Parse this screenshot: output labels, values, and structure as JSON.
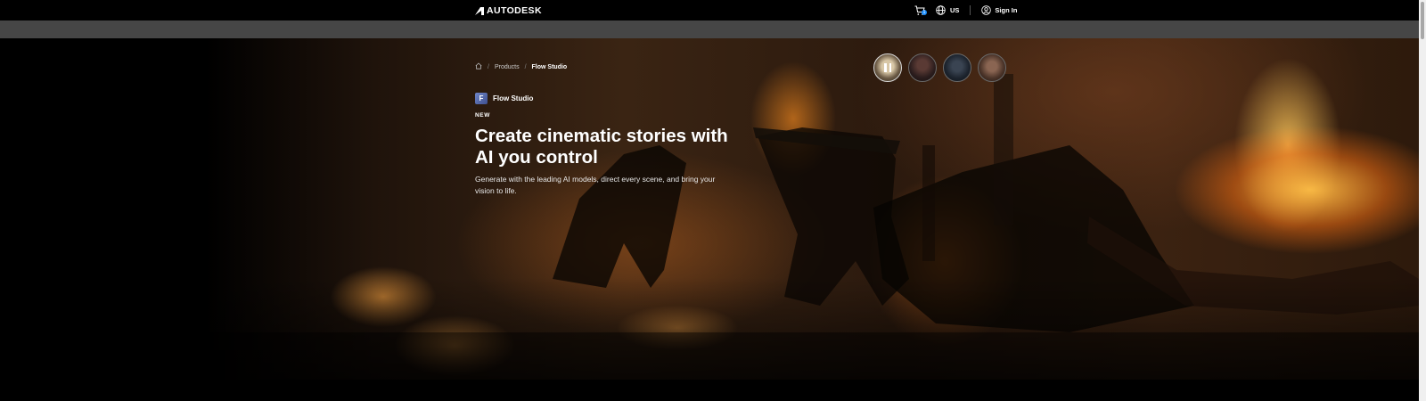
{
  "header": {
    "logo_text": "AUTODESK",
    "cart_count": "1",
    "region_label": "US",
    "signin_label": "Sign In"
  },
  "breadcrumb": {
    "items": [
      "Products",
      "Flow Studio"
    ]
  },
  "hero": {
    "product_badge": "F",
    "product_name": "Flow Studio",
    "eyebrow": "NEW",
    "headline": "Create cinematic stories with AI you control",
    "subcopy": "Generate with the leading AI models, direct every scene, and bring your vision to life."
  },
  "icons": {
    "logo": "autodesk-logo-icon",
    "cart": "cart-icon",
    "region": "globe-icon",
    "account": "user-icon",
    "home": "home-icon",
    "pause": "pause-icon"
  },
  "colors": {
    "nav_background": "#000000",
    "sub_bar": "#464646",
    "badge_accent": "#1e90ff",
    "product_badge": "#5267a8"
  }
}
